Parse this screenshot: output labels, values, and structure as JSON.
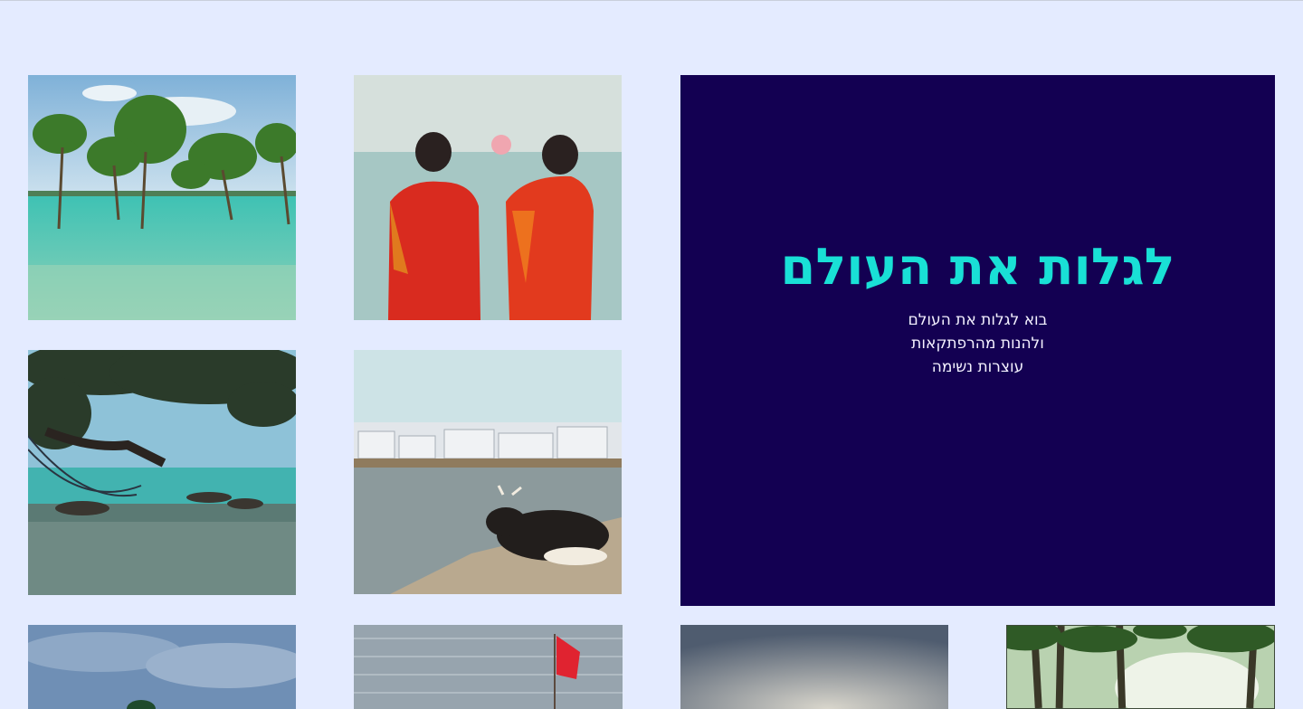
{
  "hero": {
    "title": "לגלות את העולם",
    "subtitle_lines": [
      "בוא לגלות את העולם",
      "ולהנות מהרפתקאות",
      "עוצרות נשימה"
    ]
  },
  "gallery": {
    "photos": [
      {
        "id": "mangroves-lagoon"
      },
      {
        "id": "two-women-saris-sunset"
      },
      {
        "id": "hammock-beach-tree"
      },
      {
        "id": "cow-lakeside-town"
      },
      {
        "id": "cloudy-shore"
      },
      {
        "id": "sea-red-flag"
      },
      {
        "id": "misty-sky"
      },
      {
        "id": "palm-forest"
      }
    ]
  }
}
